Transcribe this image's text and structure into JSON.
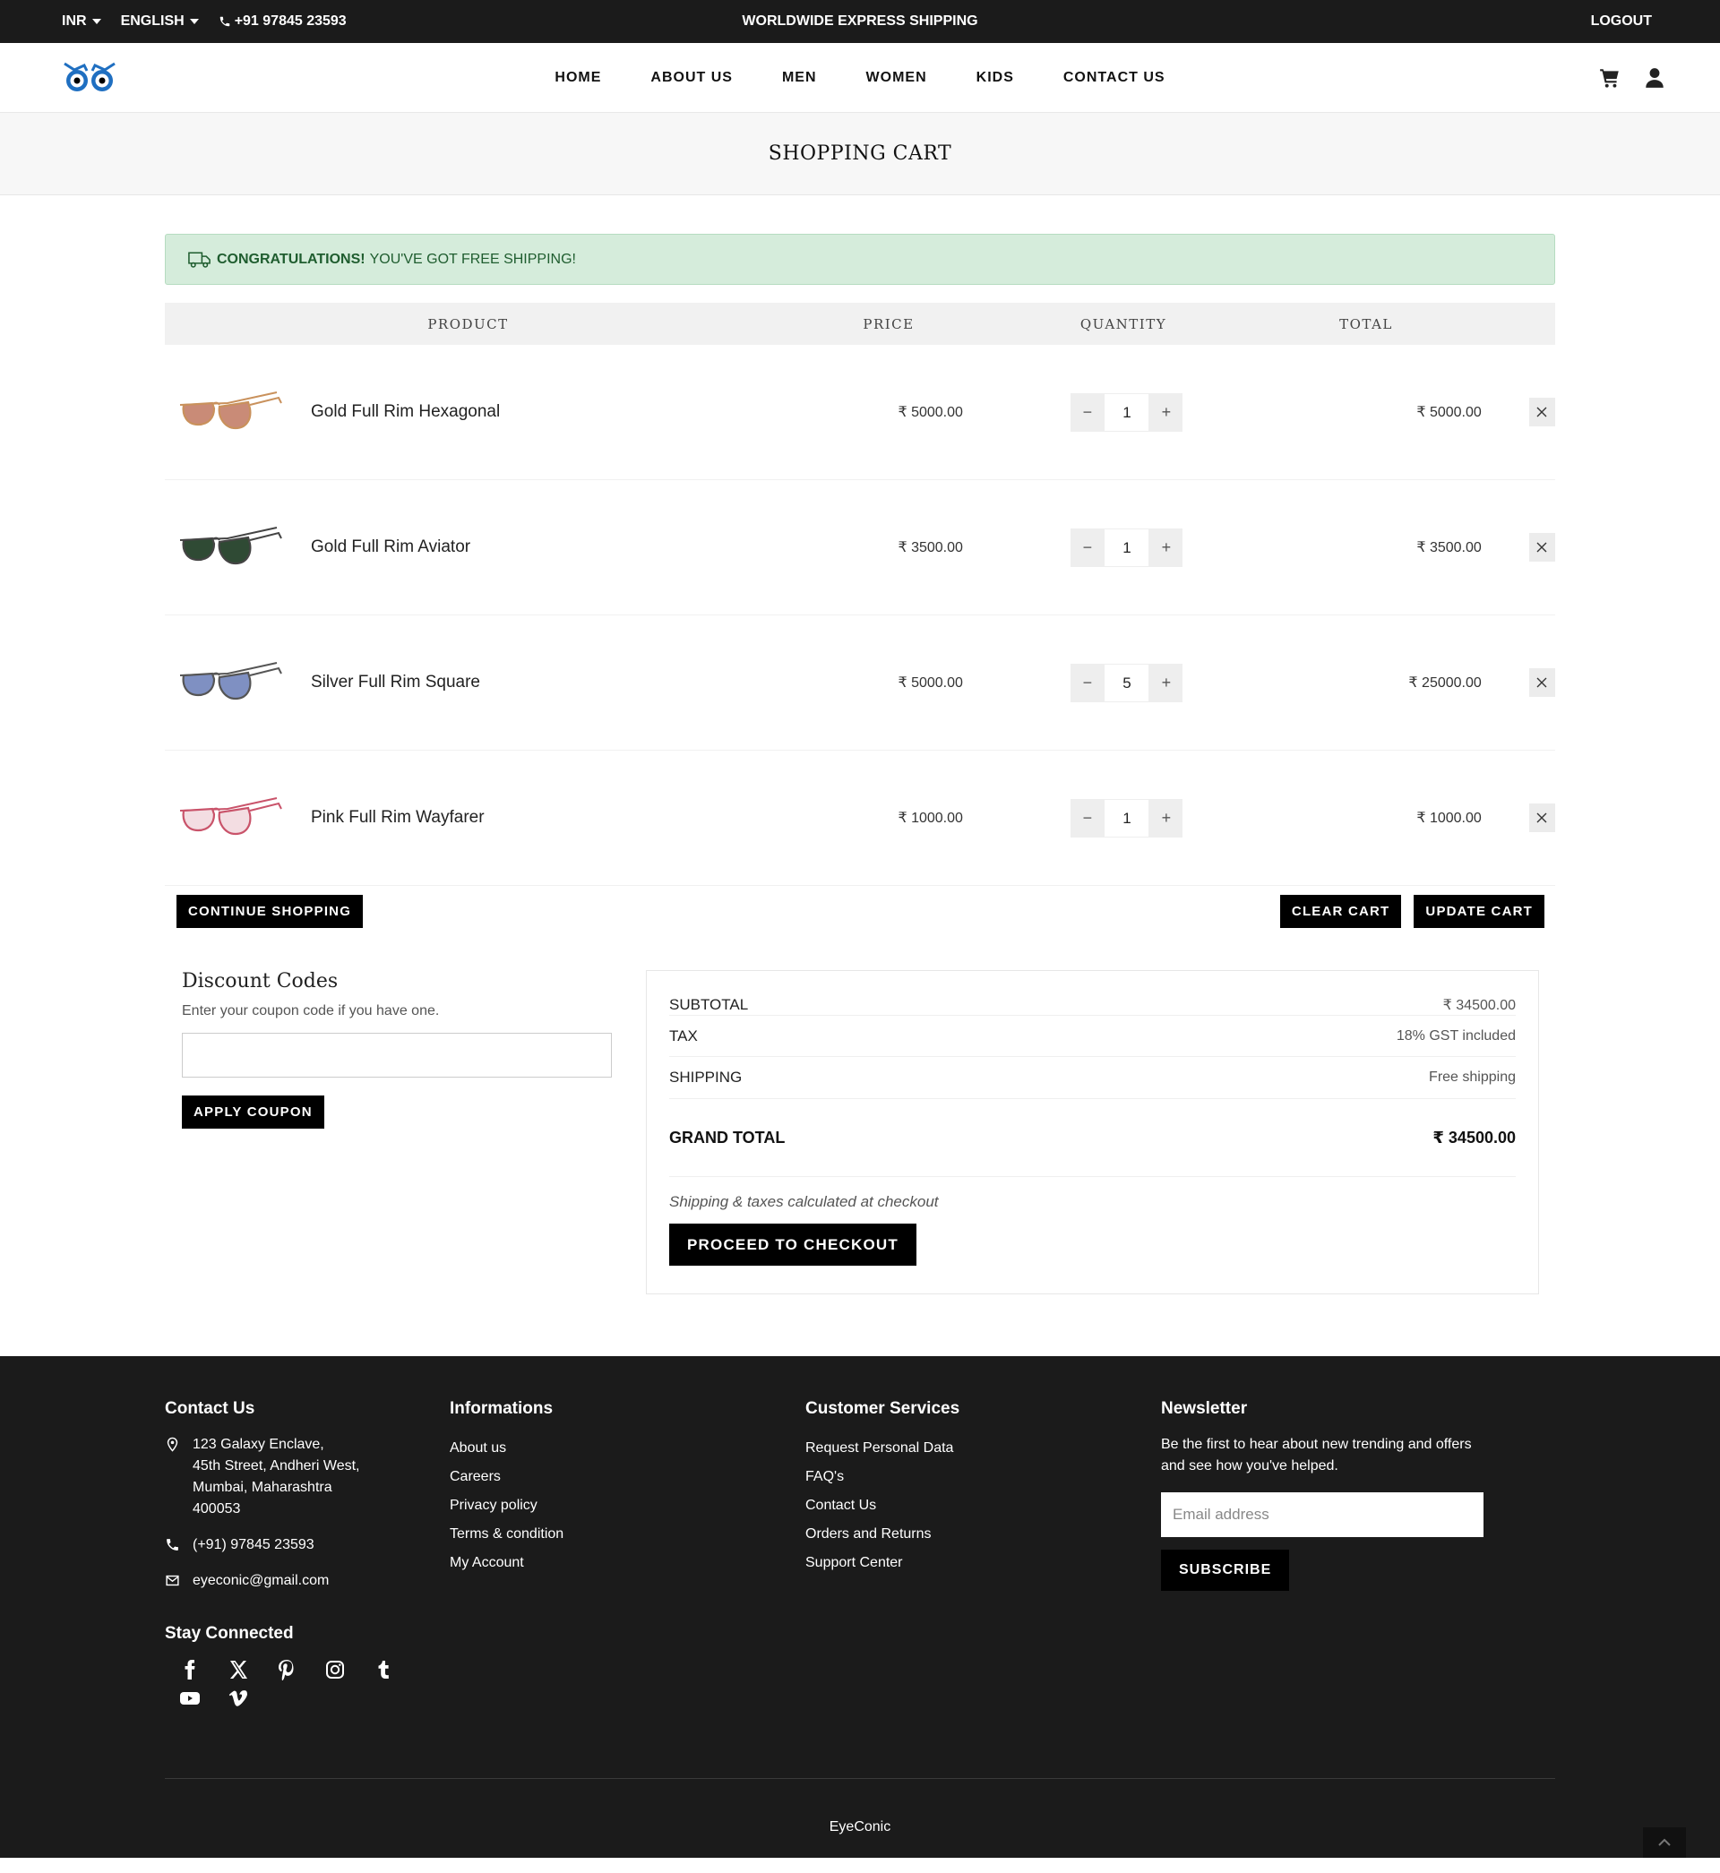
{
  "topbar": {
    "currency": "INR",
    "language": "ENGLISH",
    "phone": "+91 97845 23593",
    "promo": "WORLDWIDE EXPRESS SHIPPING",
    "logout": "LOGOUT"
  },
  "nav": {
    "items": [
      "HOME",
      "ABOUT US",
      "MEN",
      "WOMEN",
      "KIDS",
      "CONTACT US"
    ]
  },
  "page": {
    "title": "SHOPPING CART"
  },
  "notice": {
    "strong": "CONGRATULATIONS!",
    "text": "YOU'VE GOT FREE SHIPPING!"
  },
  "cart": {
    "headers": {
      "product": "PRODUCT",
      "price": "PRICE",
      "quantity": "QUANTITY",
      "total": "TOTAL"
    },
    "items": [
      {
        "name": "Gold Full Rim Hexagonal",
        "price": "₹ 5000.00",
        "qty": "1",
        "total": "₹ 5000.00",
        "frame": "#c9915c",
        "lens": "#c98b77"
      },
      {
        "name": "Gold Full Rim Aviator",
        "price": "₹ 3500.00",
        "qty": "1",
        "total": "₹ 3500.00",
        "frame": "#444444",
        "lens": "#2f4a34"
      },
      {
        "name": "Silver Full Rim Square",
        "price": "₹ 5000.00",
        "qty": "5",
        "total": "₹ 25000.00",
        "frame": "#555555",
        "lens": "#7f90c2"
      },
      {
        "name": "Pink Full Rim Wayfarer",
        "price": "₹ 1000.00",
        "qty": "1",
        "total": "₹ 1000.00",
        "frame": "#c9536a",
        "lens": "#f3dde2"
      }
    ],
    "continue": "CONTINUE SHOPPING",
    "clear": "CLEAR CART",
    "update": "UPDATE CART"
  },
  "discount": {
    "title": "Discount Codes",
    "hint": "Enter your coupon code if you have one.",
    "apply": "APPLY COUPON"
  },
  "summary": {
    "subtotal_label": "SUBTOTAL",
    "subtotal": "₹ 34500.00",
    "tax_label": "TAX",
    "tax": "18% GST included",
    "shipping_label": "SHIPPING",
    "shipping": "Free shipping",
    "grand_label": "GRAND TOTAL",
    "grand": "₹ 34500.00",
    "note": "Shipping & taxes calculated at checkout",
    "checkout": "PROCEED TO CHECKOUT"
  },
  "footer": {
    "contact": {
      "title": "Contact Us",
      "address": "123 Galaxy Enclave,\n45th Street, Andheri West,\nMumbai, Maharashtra\n400053",
      "phone": "(+91) 97845 23593",
      "email": "eyeconic@gmail.com"
    },
    "stay": "Stay Connected",
    "info": {
      "title": "Informations",
      "links": [
        "About us",
        "Careers",
        "Privacy policy",
        "Terms & condition",
        "My Account"
      ]
    },
    "services": {
      "title": "Customer Services",
      "links": [
        "Request Personal Data",
        "FAQ's",
        "Contact Us",
        "Orders and Returns",
        "Support Center"
      ]
    },
    "newsletter": {
      "title": "Newsletter",
      "text": "Be the first to hear about new trending and offers and see how you've helped.",
      "placeholder": "Email address",
      "button": "SUBSCRIBE"
    },
    "brand": "EyeConic"
  },
  "colors": {
    "accent": "#1f6fc1",
    "dark": "#1b1b1b",
    "notice_bg": "#d5ecdb"
  }
}
